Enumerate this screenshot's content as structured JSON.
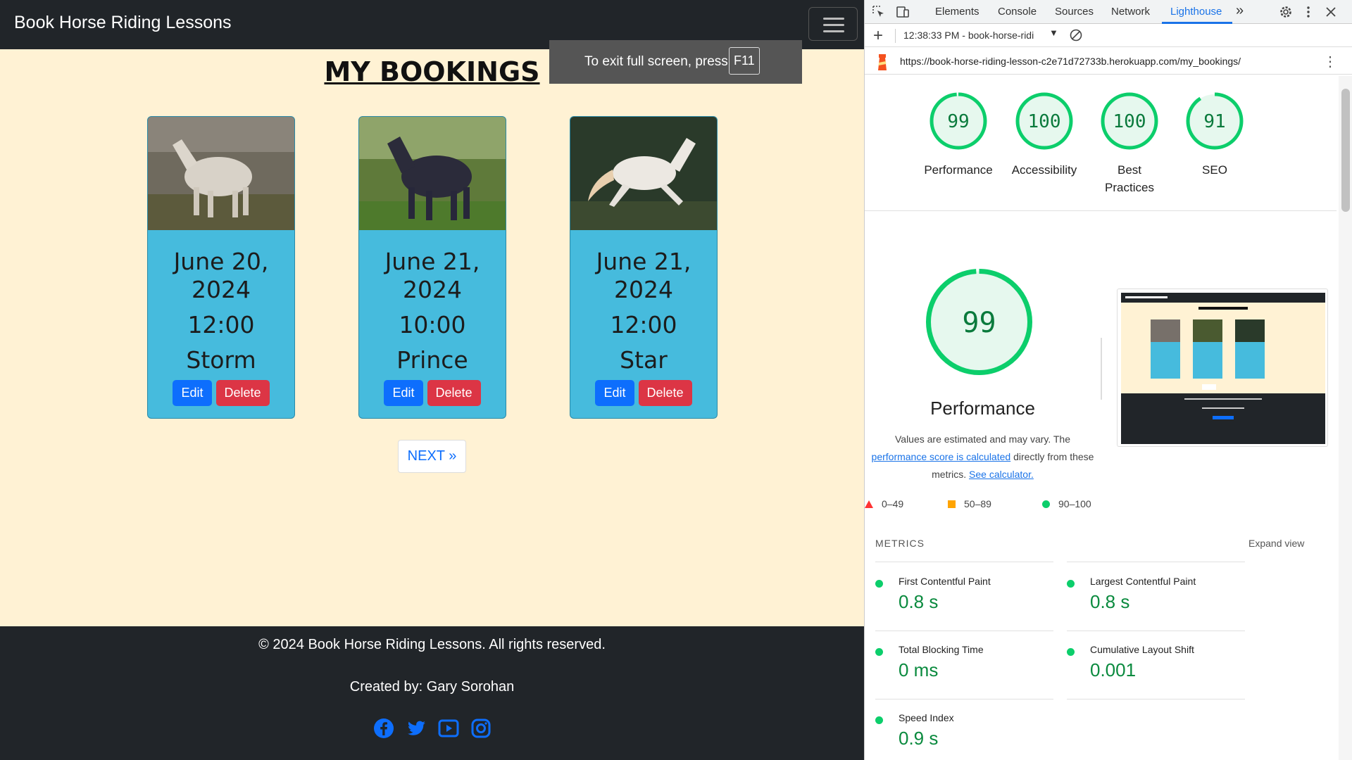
{
  "site": {
    "brand": "Book Horse Riding Lessons",
    "fullscreen_notice": "To exit full screen, press",
    "fullscreen_key": "F11",
    "page_title": "MY BOOKINGS",
    "bookings": [
      {
        "date": "June 20, 2024",
        "time": "12:00",
        "horse": "Storm",
        "edit": "Edit",
        "delete": "Delete"
      },
      {
        "date": "June 21, 2024",
        "time": "10:00",
        "horse": "Prince",
        "edit": "Edit",
        "delete": "Delete"
      },
      {
        "date": "June 21, 2024",
        "time": "12:00",
        "horse": "Star",
        "edit": "Edit",
        "delete": "Delete"
      }
    ],
    "next_label": "NEXT »",
    "footer_copy": "© 2024 Book Horse Riding Lessons. All rights reserved.",
    "footer_credit": "Created by: Gary Sorohan",
    "social_icons": [
      "facebook-icon",
      "twitter-icon",
      "youtube-icon",
      "instagram-icon"
    ],
    "colors": {
      "nav": "#212529",
      "background": "#fff2d4",
      "card": "#46bbdd",
      "edit": "#0d6efd",
      "delete": "#dc3545",
      "social": "#0d6efd"
    }
  },
  "devtools": {
    "tabs": [
      "Elements",
      "Console",
      "Sources",
      "Network",
      "Lighthouse"
    ],
    "active_tab": "Lighthouse",
    "more_tabs": "»",
    "report_time": "12:38:33 PM - book-horse-ridi",
    "url": "https://book-horse-riding-lesson-c2e71d72733b.herokuapp.com/my_bookings/",
    "scores": [
      {
        "label": "Performance",
        "value": 99
      },
      {
        "label": "Accessibility",
        "value": 100
      },
      {
        "label": "Best Practices",
        "value": 100
      },
      {
        "label": "SEO",
        "value": 91
      }
    ],
    "performance": {
      "score": 99,
      "title": "Performance",
      "desc_1": "Values are estimated and may vary. The",
      "desc_link": "performance score is calculated",
      "desc_2": "directly from these",
      "desc_3": "metrics.",
      "desc_link2": "See calculator."
    },
    "legend": [
      "0–49",
      "50–89",
      "90–100"
    ],
    "metrics_header": "METRICS",
    "expand_label": "Expand view",
    "metrics": [
      {
        "name": "First Contentful Paint",
        "value": "0.8 s"
      },
      {
        "name": "Largest Contentful Paint",
        "value": "0.8 s"
      },
      {
        "name": "Total Blocking Time",
        "value": "0 ms"
      },
      {
        "name": "Cumulative Layout Shift",
        "value": "0.001"
      },
      {
        "name": "Speed Index",
        "value": "0.9 s"
      }
    ],
    "colors": {
      "good": "#0cce6b",
      "average": "#ffa400",
      "poor": "#ff3333",
      "accent": "#1a73e8"
    }
  }
}
